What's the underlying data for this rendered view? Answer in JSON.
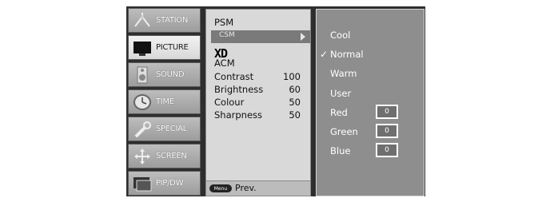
{
  "categories": [
    {
      "label": "STATION",
      "icon": "antenna-icon"
    },
    {
      "label": "PICTURE",
      "icon": "tv-screen-icon"
    },
    {
      "label": "SOUND",
      "icon": "speaker-icon"
    },
    {
      "label": "TIME",
      "icon": "clock-icon"
    },
    {
      "label": "SPECIAL",
      "icon": "wrench-icon"
    },
    {
      "label": "SCREEN",
      "icon": "arrows-icon"
    },
    {
      "label": "PIP/DW",
      "icon": "picture-in-picture-icon"
    }
  ],
  "active_category": "PICTURE",
  "picture_menu": {
    "psm": "PSM",
    "csm": "CSM",
    "xd": "XD",
    "acm": "ACM",
    "settings": [
      {
        "label": "Contrast",
        "value": "100"
      },
      {
        "label": "Brightness",
        "value": "60"
      },
      {
        "label": "Colour",
        "value": "50"
      },
      {
        "label": "Sharpness",
        "value": "50"
      }
    ],
    "footer_button": "Menu",
    "footer_text": "Prev."
  },
  "csm_menu": {
    "options": [
      "Cool",
      "Normal",
      "Warm",
      "User"
    ],
    "selected": "Normal",
    "check_mark": "✓",
    "channels": [
      {
        "label": "Red",
        "value": "0"
      },
      {
        "label": "Green",
        "value": "0"
      },
      {
        "label": "Blue",
        "value": "0"
      }
    ]
  }
}
